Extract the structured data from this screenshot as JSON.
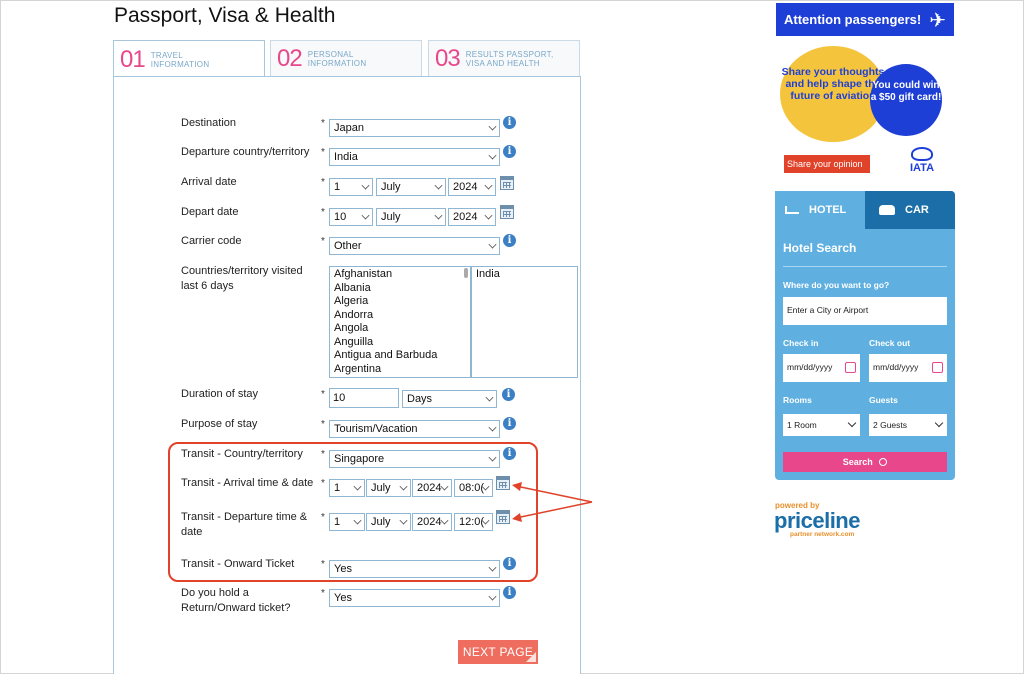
{
  "page_title": "Passport, Visa & Health",
  "tabs": [
    {
      "num": "01",
      "label_l1": "TRAVEL",
      "label_l2": "INFORMATION"
    },
    {
      "num": "02",
      "label_l1": "PERSONAL",
      "label_l2": "INFORMATION"
    },
    {
      "num": "03",
      "label_l1": "RESULTS PASSPORT,",
      "label_l2": "VISA AND HEALTH"
    }
  ],
  "form": {
    "required_mark": "*",
    "info_glyph": "i",
    "destination": {
      "label": "Destination",
      "value": "Japan"
    },
    "departure_country": {
      "label": "Departure country/territory",
      "value": "India"
    },
    "arrival_date": {
      "label": "Arrival date",
      "day": "1",
      "month": "July",
      "year": "2024"
    },
    "depart_date": {
      "label": "Depart date",
      "day": "10",
      "month": "July",
      "year": "2024"
    },
    "carrier_code": {
      "label": "Carrier code",
      "value": "Other"
    },
    "countries_visited": {
      "label": "Countries/territory visited last 6 days",
      "available": [
        "Afghanistan",
        "Albania",
        "Algeria",
        "Andorra",
        "Angola",
        "Anguilla",
        "Antigua and Barbuda",
        "Argentina"
      ],
      "selected": [
        "India"
      ]
    },
    "duration": {
      "label": "Duration of stay",
      "value": "10",
      "unit": "Days"
    },
    "purpose": {
      "label": "Purpose of stay",
      "value": "Tourism/Vacation"
    },
    "transit_country": {
      "label": "Transit - Country/territory",
      "value": "Singapore"
    },
    "transit_arrival": {
      "label": "Transit - Arrival time & date",
      "day": "1",
      "month": "July",
      "year": "2024",
      "time": "08:0("
    },
    "transit_departure": {
      "label": "Transit - Departure time & date",
      "day": "1",
      "month": "July",
      "year": "2024",
      "time": "12:0("
    },
    "transit_onward": {
      "label": "Transit - Onward Ticket",
      "value": "Yes"
    },
    "return_ticket": {
      "label": "Do you hold a Return/Onward ticket?",
      "value": "Yes"
    },
    "next_button": "NEXT PAGE"
  },
  "annotation": {
    "color": "#e0432a"
  },
  "sidebar": {
    "attention": "Attention passengers!",
    "survey_text": "Share your thoughts and help shape the future of aviation",
    "prize_text": "You could win a $50 gift card!",
    "share_button": "Share your opinion",
    "iata_logo": "IATA",
    "widget": {
      "tab_hotel": "HOTEL",
      "tab_car": "CAR",
      "title": "Hotel Search",
      "where_label": "Where do you want to go?",
      "where_placeholder": "Enter a City or Airport",
      "checkin_label": "Check in",
      "checkout_label": "Check out",
      "checkin_placeholder": "mm/dd/yyyy",
      "checkout_placeholder": "mm/dd/yyyy",
      "rooms_label": "Rooms",
      "guests_label": "Guests",
      "rooms_value": "1 Room",
      "guests_value": "2 Guests",
      "search_button": "Search"
    },
    "powered_by": "powered by",
    "priceline": "priceline",
    "partner": "partner network.com"
  },
  "colors": {
    "accent_pink": "#e8478b",
    "brand_blue": "#1e3fd6",
    "widget_blue": "#5fb0e0"
  }
}
